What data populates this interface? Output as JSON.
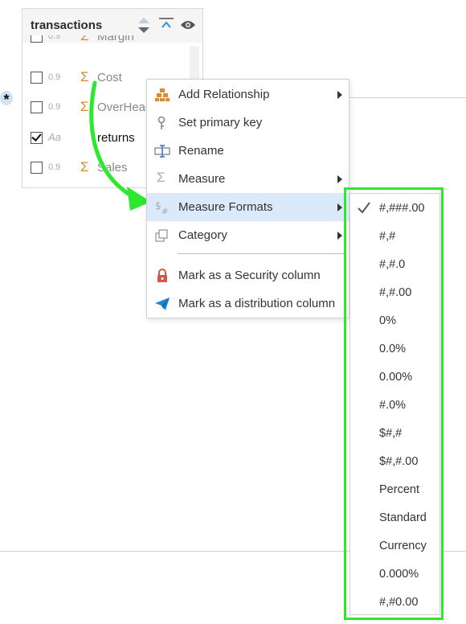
{
  "table": {
    "title": "transactions",
    "columns": [
      {
        "name": "Margin",
        "type": "0.9",
        "icon": "sigma-icon",
        "checked": false
      },
      {
        "name": "Cost",
        "type": "0.9",
        "icon": "sigma-icon",
        "checked": false
      },
      {
        "name": "OverHead",
        "type": "0.9",
        "icon": "sigma-icon",
        "checked": false
      },
      {
        "name": "returns",
        "type": "Aa",
        "icon": "",
        "checked": true
      },
      {
        "name": "Sales",
        "type": "0.9",
        "icon": "sigma-icon",
        "checked": false
      }
    ]
  },
  "icons": {
    "sigma": "Σ",
    "star": "*"
  },
  "context_menu": {
    "items": [
      {
        "label": "Add Relationship",
        "icon": "hierarchy-icon",
        "submenu": true
      },
      {
        "label": "Set primary key",
        "icon": "key-icon",
        "submenu": false
      },
      {
        "label": "Rename",
        "icon": "rename-icon",
        "submenu": false
      },
      {
        "label": "Measure",
        "icon": "sigma-icon",
        "submenu": true
      },
      {
        "label": "Measure Formats",
        "icon": "measure-format-icon",
        "submenu": true,
        "active": true
      },
      {
        "label": "Category",
        "icon": "category-icon",
        "submenu": true
      },
      {
        "label": "Mark as a Security column",
        "icon": "lock-icon",
        "submenu": false
      },
      {
        "label": "Mark as a distribution column",
        "icon": "paper-plane-icon",
        "submenu": false
      }
    ]
  },
  "formats_menu": {
    "selected": "#,###.00",
    "items": [
      "#,###.00",
      "#,#",
      "#,#.0",
      "#,#.00",
      "0%",
      "0.0%",
      "0.00%",
      "#.0%",
      "$#,#",
      "$#,#.00",
      "Percent",
      "Standard",
      "Currency",
      "0.000%",
      "#,#0.00"
    ]
  },
  "colors": {
    "highlight_green": "#2ee82e",
    "active_item_bg": "#daeafa",
    "sigma_orange": "#d58a2e",
    "lock_red": "#d9534f",
    "plane_blue": "#1e88d6"
  }
}
